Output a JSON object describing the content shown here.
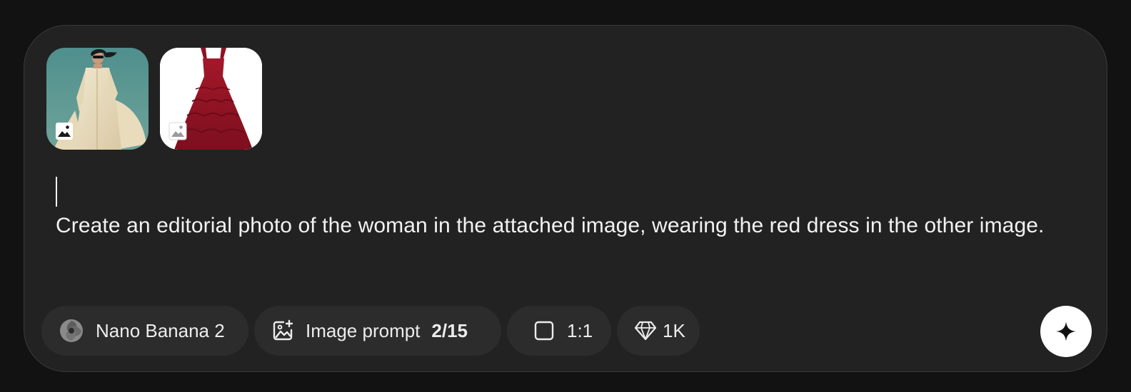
{
  "composer": {
    "attachments": [
      {
        "kind": "image",
        "badge_icon": "image-icon",
        "subject": "woman in cream suit"
      },
      {
        "kind": "image",
        "badge_icon": "image-icon",
        "subject": "red gown"
      }
    ],
    "prompt_text": "Create an editorial photo of the woman in the attached image, wearing the red dress in the other image."
  },
  "toolbar": {
    "model": {
      "icon": "model-swirl-icon",
      "label": "Nano Banana 2"
    },
    "image_prompt": {
      "icon": "image-add-icon",
      "label": "Image prompt",
      "count": "2/15"
    },
    "aspect_ratio": {
      "icon": "square-icon",
      "label": "1:1"
    },
    "resolution": {
      "icon": "diamond-icon",
      "label": "1K"
    },
    "send": {
      "icon": "sparkle-icon"
    }
  },
  "colors": {
    "page_bg": "#121212",
    "panel_bg": "#222222",
    "pill_bg": "#2c2c2c",
    "text": "#f2f2f2",
    "send_bg": "#ffffff"
  }
}
